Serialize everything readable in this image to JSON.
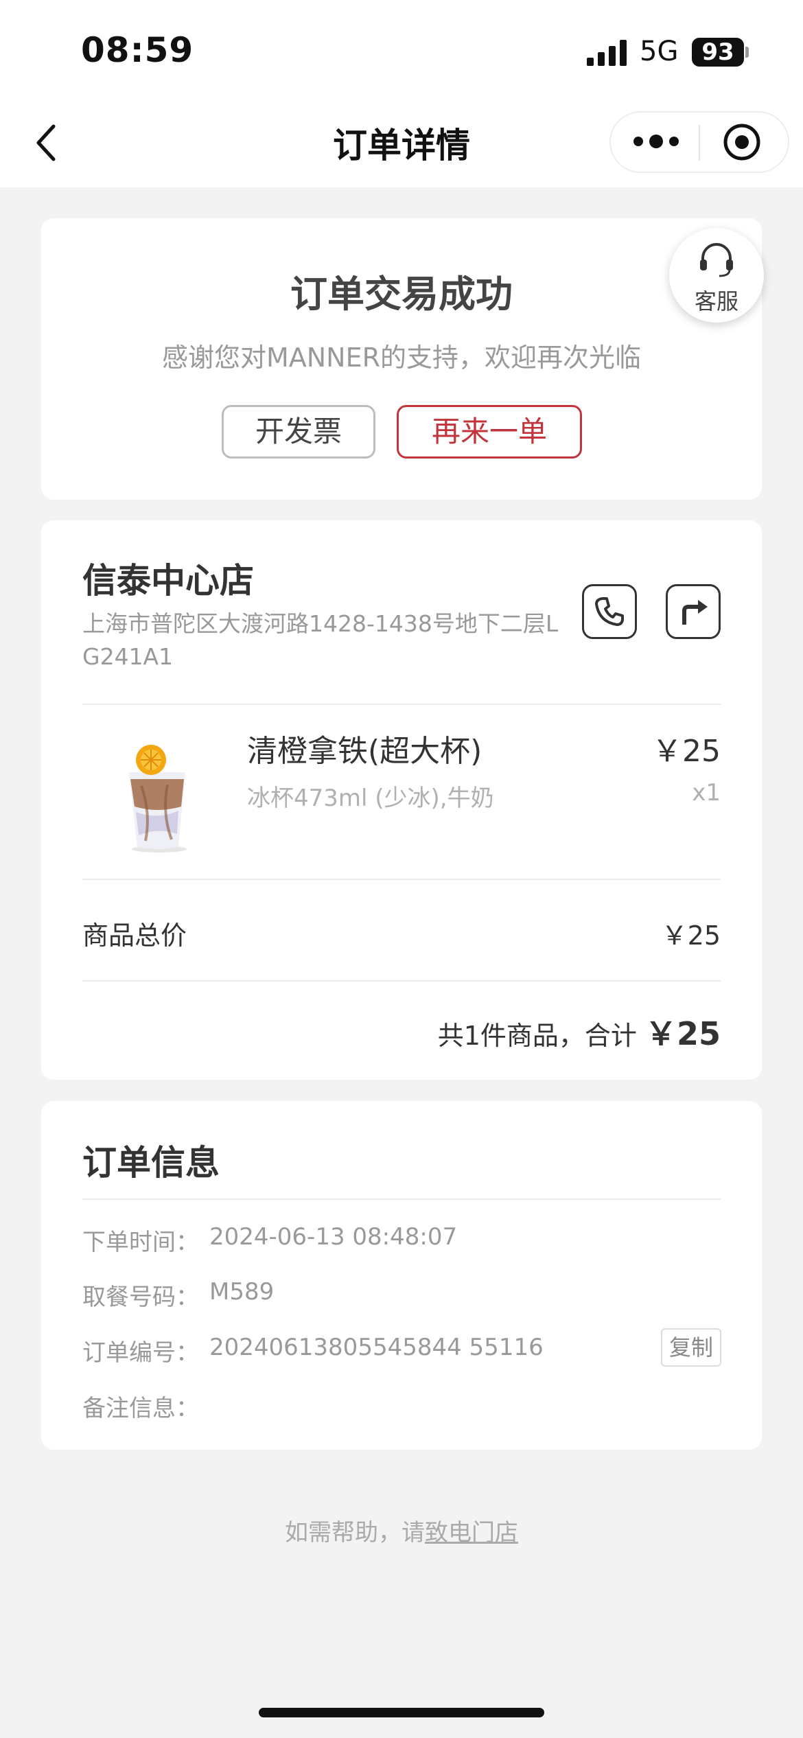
{
  "status_bar": {
    "time": "08:59",
    "network": "5G",
    "battery": "93"
  },
  "nav": {
    "title": "订单详情"
  },
  "order_status": {
    "title": "订单交易成功",
    "subtitle": "感谢您对MANNER的支持，欢迎再次光临",
    "invoice_button": "开发票",
    "reorder_button": "再来一单",
    "service_label": "客服"
  },
  "store": {
    "name": "信泰中心店",
    "address": "上海市普陀区大渡河路1428-1438号地下二层LG241A1"
  },
  "product": {
    "name": "清橙拿铁(超大杯)",
    "spec": "冰杯473ml (少冰),牛奶",
    "price": "￥25",
    "quantity": "x1"
  },
  "summary": {
    "subtotal_label": "商品总价",
    "subtotal_value": "￥25",
    "total_prefix": "共1件商品，合计",
    "total_value": "￥25"
  },
  "order_info": {
    "title": "订单信息",
    "order_time_label": "下单时间：",
    "order_time_value": "2024-06-13 08:48:07",
    "pickup_label": "取餐号码：",
    "pickup_value": "M589",
    "order_no_label": "订单编号：",
    "order_no_value": "20240613805545844 55116",
    "copy_button": "复制",
    "remark_label": "备注信息："
  },
  "help": {
    "prefix": "如需帮助，请",
    "link": "致电门店"
  },
  "colors": {
    "accent": "#c2343b",
    "background": "#f3f3f3"
  }
}
